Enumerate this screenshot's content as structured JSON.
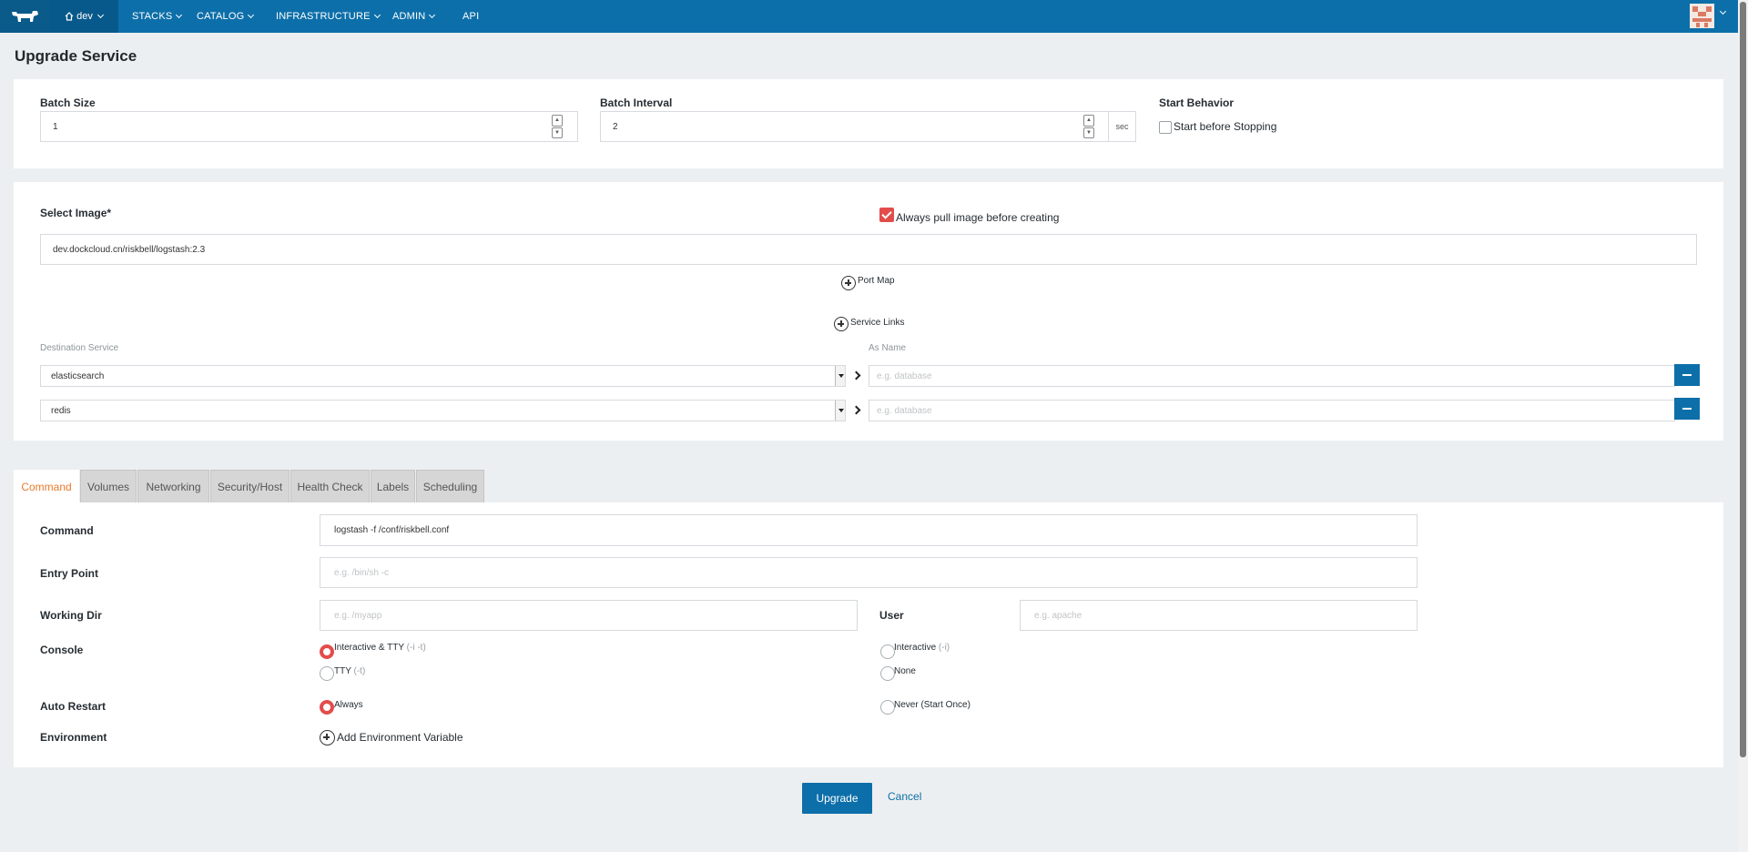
{
  "nav": {
    "env": "dev",
    "items": [
      "STACKS",
      "CATALOG",
      "INFRASTRUCTURE",
      "ADMIN",
      "API"
    ],
    "icons": {
      "logo": "rancher-cow-icon",
      "home": "home-icon"
    }
  },
  "page": {
    "title": "Upgrade Service"
  },
  "upgrade": {
    "batch_size_label": "Batch Size",
    "batch_size_value": "1",
    "batch_interval_label": "Batch Interval",
    "batch_interval_value": "2",
    "batch_interval_unit": "sec",
    "start_behavior_label": "Start Behavior",
    "start_before_stopping_label": "Start before Stopping",
    "start_before_stopping_checked": false
  },
  "image": {
    "label": "Select Image*",
    "value": "dev.dockcloud.cn/riskbell/logstash:2.3",
    "always_pull_label": "Always pull image before creating",
    "always_pull_checked": true,
    "port_map_label": "Port Map",
    "service_links_label": "Service Links"
  },
  "links": {
    "dest_header": "Destination Service",
    "as_name_header": "As Name",
    "rows": [
      {
        "service": "elasticsearch",
        "as_name_placeholder": "e.g. database"
      },
      {
        "service": "redis",
        "as_name_placeholder": "e.g. database"
      }
    ]
  },
  "tabs": [
    "Command",
    "Volumes",
    "Networking",
    "Security/Host",
    "Health Check",
    "Labels",
    "Scheduling"
  ],
  "active_tab": "Command",
  "command": {
    "command_label": "Command",
    "command_value": "logstash -f /conf/riskbell.conf",
    "entry_point_label": "Entry Point",
    "entry_point_placeholder": "e.g. /bin/sh -c",
    "working_dir_label": "Working Dir",
    "working_dir_placeholder": "e.g. /myapp",
    "user_label": "User",
    "user_placeholder": "e.g. apache",
    "console_label": "Console",
    "console_options": [
      {
        "label": "Interactive & TTY",
        "hint": "(-i -t)",
        "checked": true
      },
      {
        "label": "Interactive",
        "hint": "(-i)",
        "checked": false
      },
      {
        "label": "TTY",
        "hint": "(-t)",
        "checked": false
      },
      {
        "label": "None",
        "hint": "",
        "checked": false
      }
    ],
    "auto_restart_label": "Auto Restart",
    "restart_options": [
      {
        "label": "Always",
        "checked": true
      },
      {
        "label": "Never (Start Once)",
        "checked": false
      }
    ],
    "environment_label": "Environment",
    "add_env_label": "Add Environment Variable"
  },
  "actions": {
    "upgrade": "Upgrade",
    "cancel": "Cancel"
  },
  "colors": {
    "nav": "#0d6fa9",
    "accent": "#e24d4b",
    "tab_active": "#e87a2b"
  }
}
